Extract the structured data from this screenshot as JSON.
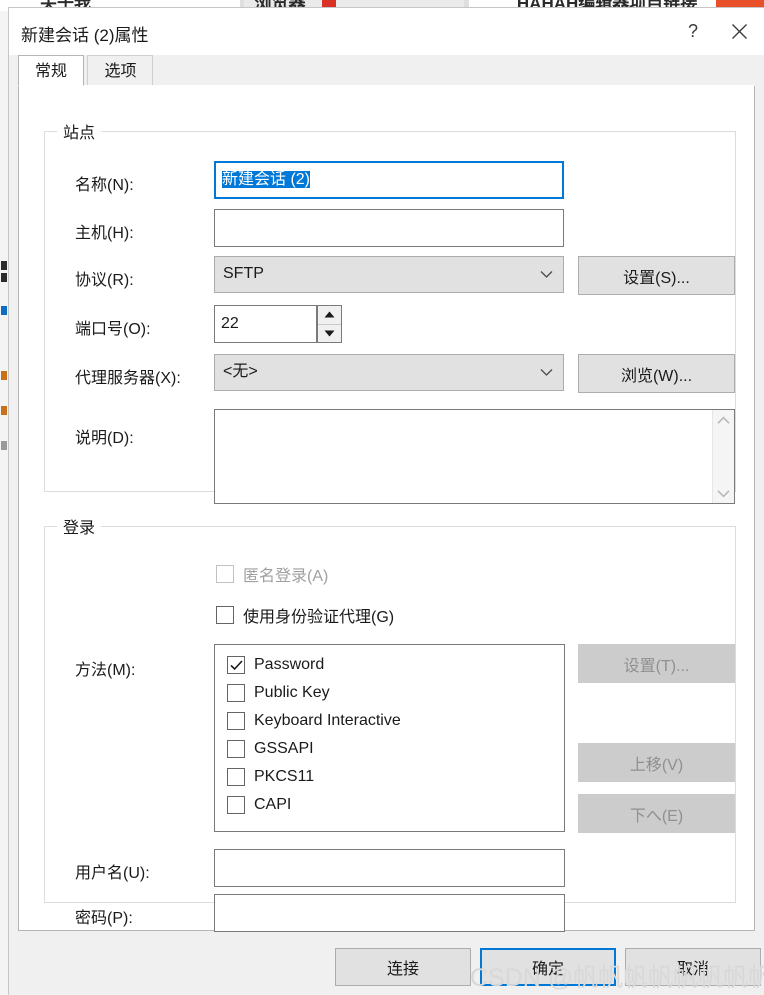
{
  "background": {
    "tabs": [
      "关于我",
      "浏览器",
      "HAHAH编辑器项目链接"
    ],
    "favicon": "site-favicon",
    "accent_red": "#e8502a"
  },
  "window": {
    "title": "新建会话 (2)属性",
    "help_glyph": "?",
    "close_glyph": "✕"
  },
  "tabs": [
    {
      "label": "常规",
      "active": true
    },
    {
      "label": "选项",
      "active": false
    }
  ],
  "site_group": {
    "legend": "站点",
    "name_label": "名称(N):",
    "name_value": "新建会话 (2)",
    "host_label": "主机(H):",
    "host_value": "",
    "protocol_label": "协议(R):",
    "protocol_value": "SFTP",
    "protocol_settings_button": "设置(S)...",
    "port_label": "端口号(O):",
    "port_value": "22",
    "proxy_label": "代理服务器(X):",
    "proxy_value": "<无>",
    "proxy_browse_button": "浏览(W)...",
    "description_label": "说明(D):",
    "description_value": ""
  },
  "login_group": {
    "legend": "登录",
    "anonymous_label": "匿名登录(A)",
    "anonymous_checked": false,
    "anonymous_disabled": true,
    "auth_agent_label": "使用身份验证代理(G)",
    "auth_agent_checked": false,
    "method_label": "方法(M):",
    "methods": [
      {
        "label": "Password",
        "checked": true
      },
      {
        "label": "Public Key",
        "checked": false
      },
      {
        "label": "Keyboard Interactive",
        "checked": false
      },
      {
        "label": "GSSAPI",
        "checked": false
      },
      {
        "label": "PKCS11",
        "checked": false
      },
      {
        "label": "CAPI",
        "checked": false
      }
    ],
    "method_settings_button": "设置(T)...",
    "move_up_button": "上移(V)",
    "move_down_button": "下へ(E)",
    "username_label": "用户名(U):",
    "username_value": "",
    "password_label": "密码(P):",
    "password_value": ""
  },
  "footer": {
    "connect_button": "连接",
    "ok_button": "确定",
    "cancel_button": "取消"
  },
  "watermark": "CSDN @帆帆帆帆帆帆帆帆帆帆帆帆",
  "colors": {
    "focus_blue": "#0078d7",
    "selection_blue": "#0078d7",
    "dialog_face": "#f0f0f0",
    "button_face": "#e1e1e1",
    "disabled_gray": "#cccccc"
  }
}
